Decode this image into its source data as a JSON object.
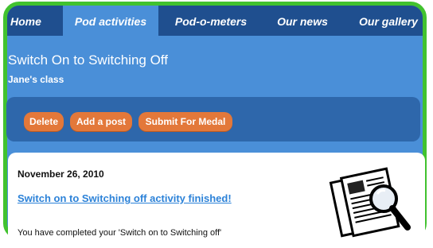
{
  "nav": {
    "tabs": [
      {
        "label": "Home"
      },
      {
        "label": "Pod activities"
      },
      {
        "label": "Pod-o-meters"
      },
      {
        "label": "Our news"
      },
      {
        "label": "Our gallery"
      }
    ],
    "active_tab": "Pod activities"
  },
  "header": {
    "title": "Switch On to Switching Off",
    "subtitle": "Jane's class"
  },
  "toolbar": {
    "delete_label": "Delete",
    "add_post_label": "Add a post",
    "submit_label": "Submit For Medal"
  },
  "post": {
    "date": "November 26, 2010",
    "title": "Switch on to Switching off activity finished!",
    "excerpt": "You have completed your 'Switch on to Switching off'",
    "icon": "document-magnifier-icon"
  },
  "colors": {
    "frame_green": "#41c22f",
    "page_blue": "#4a8fd8",
    "nav_dark_blue": "#1f4f8f",
    "toolbar_blue": "#2e67ab",
    "button_orange": "#e3783a",
    "link_blue": "#2c82d8"
  }
}
